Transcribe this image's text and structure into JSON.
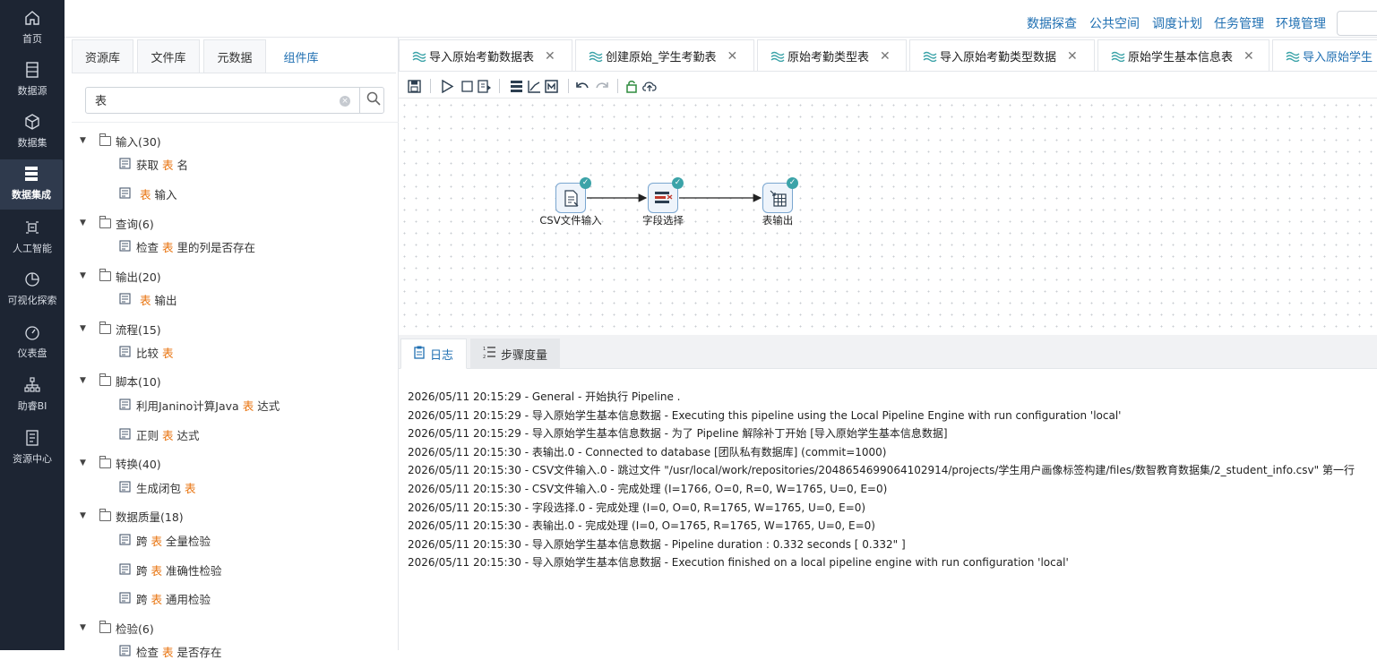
{
  "nav": [
    {
      "label": "首页",
      "icon": "home-icon"
    },
    {
      "label": "数据源",
      "icon": "datasource-icon"
    },
    {
      "label": "数据集",
      "icon": "cube-icon"
    },
    {
      "label": "数据集成",
      "icon": "server-icon",
      "active": true
    },
    {
      "label": "人工智能",
      "icon": "ai-icon"
    },
    {
      "label": "可视化探索",
      "icon": "pie-chart-icon"
    },
    {
      "label": "仪表盘",
      "icon": "gauge-icon"
    },
    {
      "label": "助睿BI",
      "icon": "org-chart-icon"
    },
    {
      "label": "资源中心",
      "icon": "document-icon"
    }
  ],
  "topbar": {
    "links": [
      "数据探查",
      "公共空间",
      "调度计划",
      "任务管理",
      "环境管理"
    ]
  },
  "resource_tabs": [
    "资源库",
    "文件库",
    "元数据",
    "组件库"
  ],
  "resource_active_tab": "组件库",
  "search": {
    "value": "表"
  },
  "tree": [
    {
      "type": "cat",
      "label": "输入(30)"
    },
    {
      "type": "leaf",
      "pre": "获取",
      "hl": "表",
      "post": "名"
    },
    {
      "type": "leaf",
      "pre": "",
      "hl": "表",
      "post": "输入"
    },
    {
      "type": "cat",
      "label": "查询(6)"
    },
    {
      "type": "leaf",
      "pre": "检查",
      "hl": "表",
      "post": "里的列是否存在"
    },
    {
      "type": "cat",
      "label": "输出(20)"
    },
    {
      "type": "leaf",
      "pre": "",
      "hl": "表",
      "post": "输出"
    },
    {
      "type": "cat",
      "label": "流程(15)"
    },
    {
      "type": "leaf",
      "pre": "比较",
      "hl": "表",
      "post": ""
    },
    {
      "type": "cat",
      "label": "脚本(10)"
    },
    {
      "type": "leaf",
      "pre": "利用Janino计算Java",
      "hl": "表",
      "post": "达式"
    },
    {
      "type": "leaf",
      "pre": "正则",
      "hl": "表",
      "post": "达式"
    },
    {
      "type": "cat",
      "label": "转换(40)"
    },
    {
      "type": "leaf",
      "pre": "生成闭包",
      "hl": "表",
      "post": ""
    },
    {
      "type": "cat",
      "label": "数据质量(18)"
    },
    {
      "type": "leaf",
      "pre": "跨",
      "hl": "表",
      "post": "全量检验"
    },
    {
      "type": "leaf",
      "pre": "跨",
      "hl": "表",
      "post": "准确性检验"
    },
    {
      "type": "leaf",
      "pre": "跨",
      "hl": "表",
      "post": "通用检验"
    },
    {
      "type": "cat",
      "label": "检验(6)"
    },
    {
      "type": "leaf",
      "pre": "检查",
      "hl": "表",
      "post": "是否存在"
    }
  ],
  "editor_tabs": [
    {
      "label": "导入原始考勤数据表",
      "closable": true
    },
    {
      "label": "创建原始_学生考勤表",
      "closable": true
    },
    {
      "label": "原始考勤类型表",
      "closable": true
    },
    {
      "label": "导入原始考勤类型数据",
      "closable": true
    },
    {
      "label": "原始学生基本信息表",
      "closable": true
    },
    {
      "label": "导入原始学生",
      "closable": false,
      "active": true
    }
  ],
  "toolbar": [
    "save-icon",
    "run-icon",
    "stop-icon",
    "preview-icon",
    "layout-icon",
    "analyze-icon",
    "metrics-icon",
    "undo-icon",
    "redo-icon",
    "lock-icon",
    "upload-icon"
  ],
  "steps": [
    {
      "label": "CSV文件输入",
      "icon": "csv-input-icon"
    },
    {
      "label": "字段选择",
      "icon": "field-select-icon"
    },
    {
      "label": "表输出",
      "icon": "table-output-icon"
    }
  ],
  "log_tabs": [
    "日志",
    "步骤度量"
  ],
  "log_lines": [
    "2026/05/11 20:15:29 - General - 开始执行 Pipeline .",
    "2026/05/11 20:15:29 - 导入原始学生基本信息数据 - Executing this pipeline using the Local Pipeline Engine with run configuration 'local'",
    "2026/05/11 20:15:29 - 导入原始学生基本信息数据 - 为了 Pipeline 解除补丁开始 [导入原始学生基本信息数据]",
    "2026/05/11 20:15:30 - 表输出.0 - Connected to database [团队私有数据库] (commit=1000)",
    "2026/05/11 20:15:30 - CSV文件输入.0 - 跳过文件 \"/usr/local/work/repositories/2048654699064102914/projects/学生用户画像标签构建/files/数智教育数据集/2_student_info.csv\" 第一行",
    "2026/05/11 20:15:30 - CSV文件输入.0 - 完成处理 (I=1766, O=0, R=0, W=1765, U=0, E=0)",
    "2026/05/11 20:15:30 - 字段选择.0 - 完成处理 (I=0, O=0, R=1765, W=1765, U=0, E=0)",
    "2026/05/11 20:15:30 - 表输出.0 - 完成处理 (I=0, O=1765, R=1765, W=1765, U=0, E=0)",
    "2026/05/11 20:15:30 - 导入原始学生基本信息数据 - Pipeline duration : 0.332 seconds [  0.332\" ]",
    "2026/05/11 20:15:30 - 导入原始学生基本信息数据 - Execution finished on a local pipeline engine with run configuration 'local'"
  ]
}
